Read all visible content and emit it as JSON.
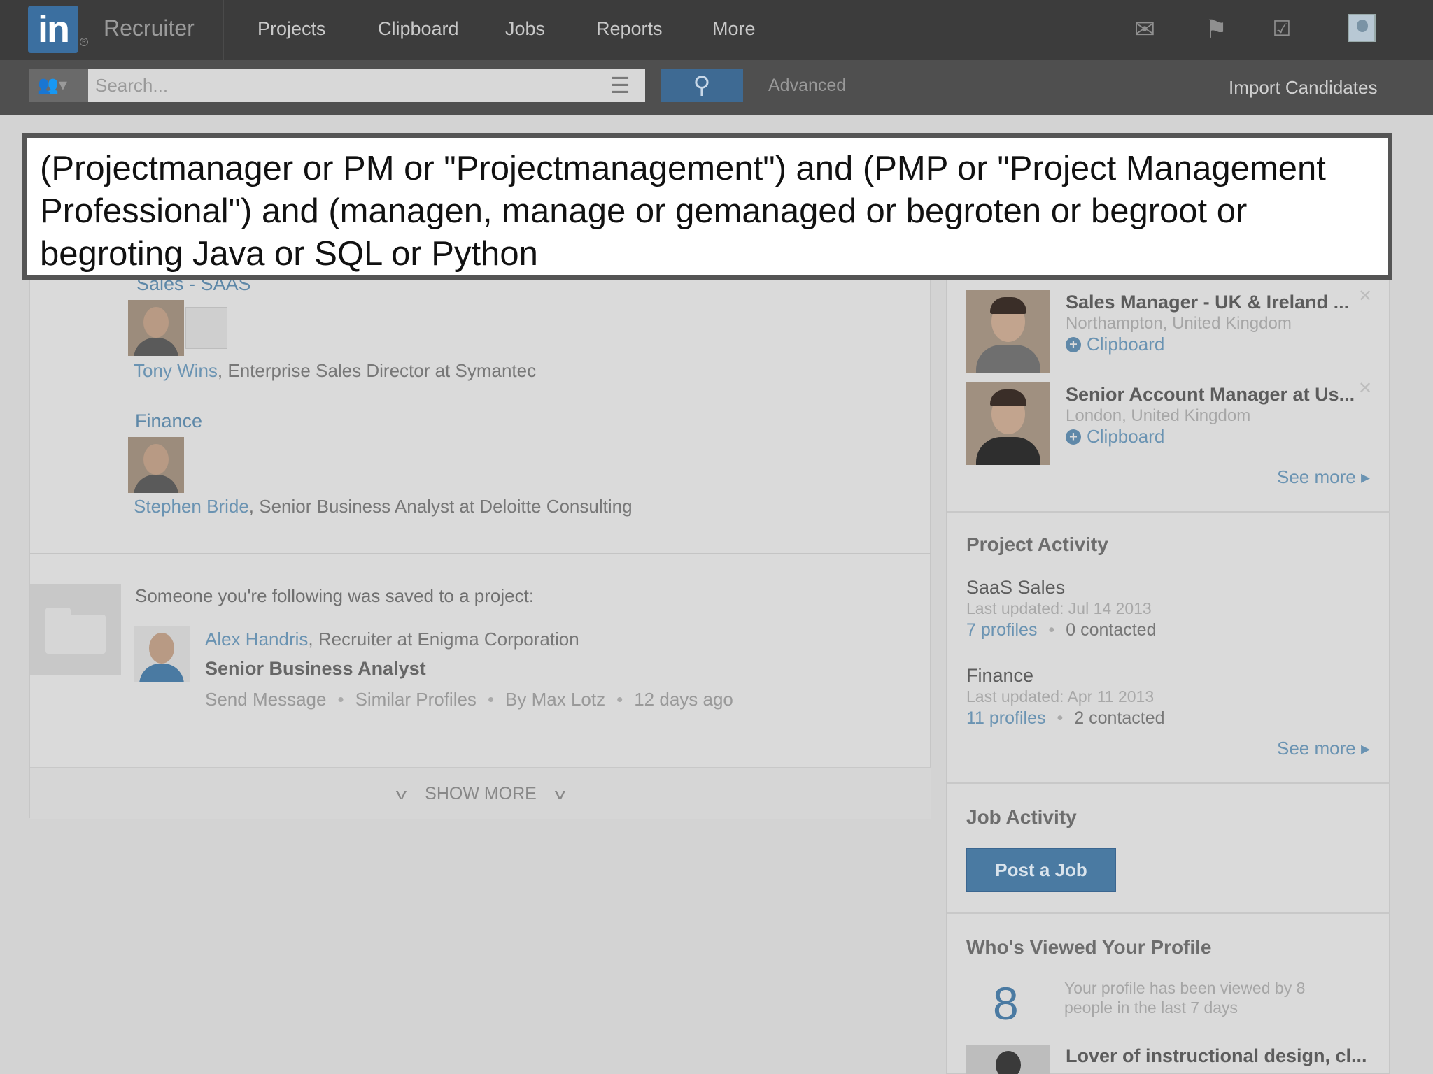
{
  "nav": {
    "logo": "in",
    "brand": "Recruiter",
    "items": [
      "Projects",
      "Clipboard",
      "Jobs",
      "Reports",
      "More"
    ],
    "icons": [
      "mail-icon",
      "flag-icon",
      "tasks-icon"
    ]
  },
  "search": {
    "placeholder": "Search...",
    "advanced": "Advanced",
    "import": "Import Candidates"
  },
  "overlay": {
    "query": "(Projectmanager or PM or \"Projectmanagement\") and (PMP or \"Project Management Professional\") and (managen, manage or gemanaged or begroten or begroot or begroting Java or SQL or Python"
  },
  "feed": {
    "group1": {
      "title": "Sales - SAAS",
      "person_name": "Tony Wins",
      "person_role": "Enterprise Sales Director at Symantec"
    },
    "group2": {
      "title": "Finance",
      "person_name": "Stephen Bride",
      "person_role": "Senior Business Analyst at Deloitte Consulting"
    },
    "notification": {
      "text": "Someone you're following was saved to a project:",
      "person_name": "Alex Handris",
      "person_role": "Recruiter at Enigma Corporation",
      "project": "Senior Business Analyst",
      "send_message": "Send Message",
      "similar": "Similar Profiles",
      "by": "By Max Lotz",
      "when": "12 days ago"
    },
    "show_more": "SHOW MORE"
  },
  "right": {
    "candidates": [
      {
        "title": "Sales Manager - UK & Ireland ...",
        "location": "Northampton, United Kingdom",
        "clipboard": "Clipboard"
      },
      {
        "title": "Senior Account Manager at Us...",
        "location": "London, United Kingdom",
        "clipboard": "Clipboard"
      }
    ],
    "see_more": "See more",
    "project_activity": {
      "heading": "Project Activity",
      "projects": [
        {
          "name": "SaaS Sales",
          "updated": "Last updated: Jul 14 2013",
          "profiles": "7 profiles",
          "contacted": "0 contacted"
        },
        {
          "name": "Finance",
          "updated": "Last updated: Apr 11 2013",
          "profiles": "11 profiles",
          "contacted": "2 contacted"
        }
      ]
    },
    "job_activity": {
      "heading": "Job Activity",
      "post_job": "Post a Job"
    },
    "profile_views": {
      "heading": "Who's Viewed Your Profile",
      "count": "8",
      "text": "Your profile has been viewed by 8 people in the last 7 days",
      "viewer_title": "Lover of instructional design, cl..."
    }
  },
  "colors": {
    "accent": "#4a7aa2",
    "link": "#6a93b2",
    "nav_bg": "#3c3c3c"
  }
}
